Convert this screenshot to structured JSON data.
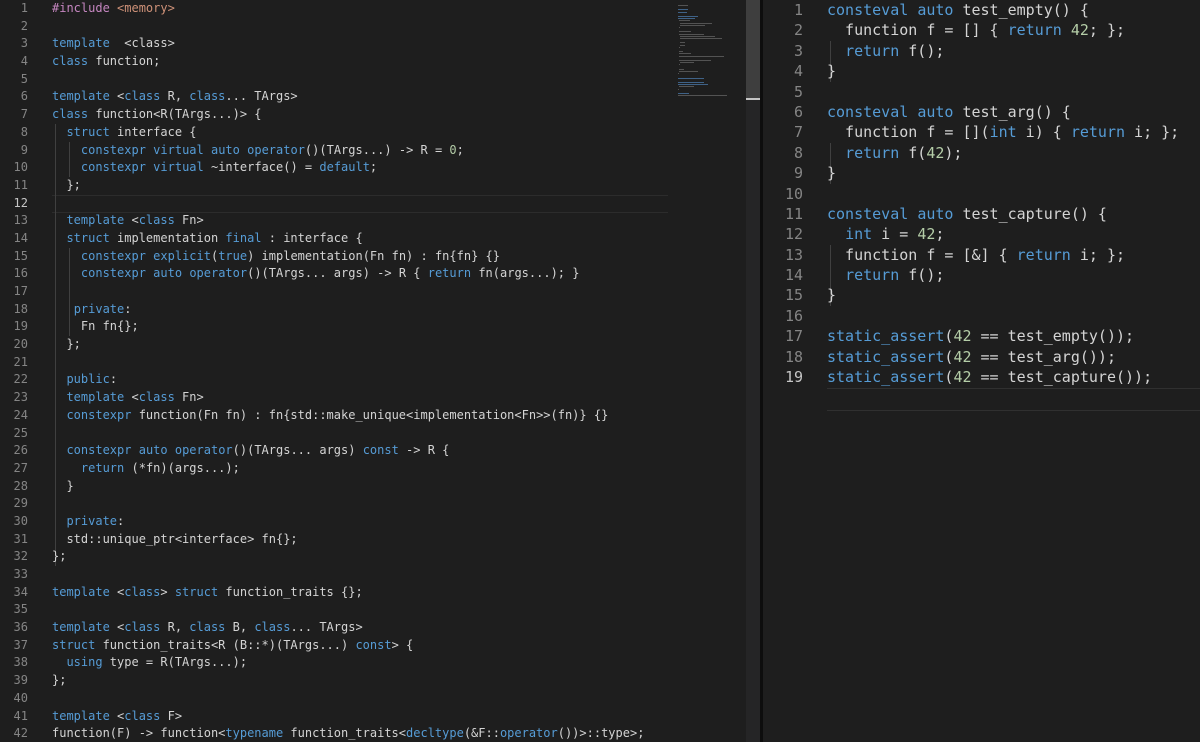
{
  "colors": {
    "background": "#1e1e1e",
    "keyword": "#569cd6",
    "number": "#b5cea8",
    "text": "#d4d4d4",
    "line_number": "#858585"
  },
  "left_editor": {
    "active_line": 12,
    "lines": [
      {
        "n": "1",
        "t": [
          [
            "inc",
            "#include "
          ],
          [
            "str",
            "<memory>"
          ]
        ]
      },
      {
        "n": "2",
        "t": []
      },
      {
        "n": "3",
        "t": [
          [
            "kw",
            "template"
          ],
          [
            "",
            "  <class>"
          ]
        ]
      },
      {
        "n": "4",
        "t": [
          [
            "kw",
            "class"
          ],
          [
            "",
            " function;"
          ]
        ]
      },
      {
        "n": "5",
        "t": []
      },
      {
        "n": "6",
        "t": [
          [
            "kw",
            "template"
          ],
          [
            "",
            " <"
          ],
          [
            "kw",
            "class"
          ],
          [
            "",
            " R, "
          ],
          [
            "kw",
            "class"
          ],
          [
            "",
            "... TArgs>"
          ]
        ]
      },
      {
        "n": "7",
        "t": [
          [
            "kw",
            "class"
          ],
          [
            "",
            " function<R(TArgs...)> {"
          ]
        ]
      },
      {
        "n": "8",
        "t": [
          [
            "",
            "  "
          ],
          [
            "kw",
            "struct"
          ],
          [
            "",
            " interface {"
          ]
        ]
      },
      {
        "n": "9",
        "t": [
          [
            "",
            "    "
          ],
          [
            "kw",
            "constexpr"
          ],
          [
            "",
            " "
          ],
          [
            "kw",
            "virtual"
          ],
          [
            "",
            " "
          ],
          [
            "kw",
            "auto"
          ],
          [
            "",
            " "
          ],
          [
            "kw",
            "operator"
          ],
          [
            "",
            "()(TArgs...) -> R = "
          ],
          [
            "num",
            "0"
          ],
          [
            "",
            ";"
          ]
        ]
      },
      {
        "n": "10",
        "t": [
          [
            "",
            "    "
          ],
          [
            "kw",
            "constexpr"
          ],
          [
            "",
            " "
          ],
          [
            "kw",
            "virtual"
          ],
          [
            "",
            " ~interface() = "
          ],
          [
            "kw",
            "default"
          ],
          [
            "",
            ";"
          ]
        ]
      },
      {
        "n": "11",
        "t": [
          [
            "",
            "  };"
          ]
        ]
      },
      {
        "n": "12",
        "t": []
      },
      {
        "n": "13",
        "t": [
          [
            "",
            "  "
          ],
          [
            "kw",
            "template"
          ],
          [
            "",
            " <"
          ],
          [
            "kw",
            "class"
          ],
          [
            "",
            " Fn>"
          ]
        ]
      },
      {
        "n": "14",
        "t": [
          [
            "",
            "  "
          ],
          [
            "kw",
            "struct"
          ],
          [
            "",
            " implementation "
          ],
          [
            "kw",
            "final"
          ],
          [
            "",
            " : interface {"
          ]
        ]
      },
      {
        "n": "15",
        "t": [
          [
            "",
            "    "
          ],
          [
            "kw",
            "constexpr"
          ],
          [
            "",
            " "
          ],
          [
            "kw",
            "explicit"
          ],
          [
            "",
            "("
          ],
          [
            "kw",
            "true"
          ],
          [
            "",
            ") implementation(Fn fn) : fn{fn} {}"
          ]
        ]
      },
      {
        "n": "16",
        "t": [
          [
            "",
            "    "
          ],
          [
            "kw",
            "constexpr"
          ],
          [
            "",
            " "
          ],
          [
            "kw",
            "auto"
          ],
          [
            "",
            " "
          ],
          [
            "kw",
            "operator"
          ],
          [
            "",
            "()(TArgs... args) -> R { "
          ],
          [
            "kw",
            "return"
          ],
          [
            "",
            " fn(args...); }"
          ]
        ]
      },
      {
        "n": "17",
        "t": []
      },
      {
        "n": "18",
        "t": [
          [
            "",
            "   "
          ],
          [
            "kw",
            "private"
          ],
          [
            "",
            ":"
          ]
        ]
      },
      {
        "n": "19",
        "t": [
          [
            "",
            "    Fn fn{};"
          ]
        ]
      },
      {
        "n": "20",
        "t": [
          [
            "",
            "  };"
          ]
        ]
      },
      {
        "n": "21",
        "t": []
      },
      {
        "n": "22",
        "t": [
          [
            "",
            "  "
          ],
          [
            "kw",
            "public"
          ],
          [
            "",
            ":"
          ]
        ]
      },
      {
        "n": "23",
        "t": [
          [
            "",
            "  "
          ],
          [
            "kw",
            "template"
          ],
          [
            "",
            " <"
          ],
          [
            "kw",
            "class"
          ],
          [
            "",
            " Fn>"
          ]
        ]
      },
      {
        "n": "24",
        "t": [
          [
            "",
            "  "
          ],
          [
            "kw",
            "constexpr"
          ],
          [
            "",
            " function(Fn fn) : fn{std::make_unique<implementation<Fn>>(fn)} {}"
          ]
        ]
      },
      {
        "n": "25",
        "t": []
      },
      {
        "n": "26",
        "t": [
          [
            "",
            "  "
          ],
          [
            "kw",
            "constexpr"
          ],
          [
            "",
            " "
          ],
          [
            "kw",
            "auto"
          ],
          [
            "",
            " "
          ],
          [
            "kw",
            "operator"
          ],
          [
            "",
            "()(TArgs... args) "
          ],
          [
            "kw",
            "const"
          ],
          [
            "",
            " -> R {"
          ]
        ]
      },
      {
        "n": "27",
        "t": [
          [
            "",
            "    "
          ],
          [
            "kw",
            "return"
          ],
          [
            "",
            " (*fn)(args...);"
          ]
        ]
      },
      {
        "n": "28",
        "t": [
          [
            "",
            "  }"
          ]
        ]
      },
      {
        "n": "29",
        "t": []
      },
      {
        "n": "30",
        "t": [
          [
            "",
            "  "
          ],
          [
            "kw",
            "private"
          ],
          [
            "",
            ":"
          ]
        ]
      },
      {
        "n": "31",
        "t": [
          [
            "",
            "  std::unique_ptr<interface> fn{};"
          ]
        ]
      },
      {
        "n": "32",
        "t": [
          [
            "",
            "};"
          ]
        ]
      },
      {
        "n": "33",
        "t": []
      },
      {
        "n": "34",
        "t": [
          [
            "kw",
            "template"
          ],
          [
            "",
            " <"
          ],
          [
            "kw",
            "class"
          ],
          [
            "",
            "> "
          ],
          [
            "kw",
            "struct"
          ],
          [
            "",
            " function_traits {};"
          ]
        ]
      },
      {
        "n": "35",
        "t": []
      },
      {
        "n": "36",
        "t": [
          [
            "kw",
            "template"
          ],
          [
            "",
            " <"
          ],
          [
            "kw",
            "class"
          ],
          [
            "",
            " R, "
          ],
          [
            "kw",
            "class"
          ],
          [
            "",
            " B, "
          ],
          [
            "kw",
            "class"
          ],
          [
            "",
            "... TArgs>"
          ]
        ]
      },
      {
        "n": "37",
        "t": [
          [
            "kw",
            "struct"
          ],
          [
            "",
            " function_traits<R (B::*)(TArgs...) "
          ],
          [
            "kw",
            "const"
          ],
          [
            "",
            "> {"
          ]
        ]
      },
      {
        "n": "38",
        "t": [
          [
            "",
            "  "
          ],
          [
            "kw",
            "using"
          ],
          [
            "",
            " type = R(TArgs...);"
          ]
        ]
      },
      {
        "n": "39",
        "t": [
          [
            "",
            "};"
          ]
        ]
      },
      {
        "n": "40",
        "t": []
      },
      {
        "n": "41",
        "t": [
          [
            "kw",
            "template"
          ],
          [
            "",
            " <"
          ],
          [
            "kw",
            "class"
          ],
          [
            "",
            " F>"
          ]
        ]
      },
      {
        "n": "42",
        "t": [
          [
            "",
            "function(F) -> function<"
          ],
          [
            "kw",
            "typename"
          ],
          [
            "",
            " function_traits<"
          ],
          [
            "kw",
            "decltype"
          ],
          [
            "",
            "(&F::"
          ],
          [
            "kw",
            "operator"
          ],
          [
            "",
            "())>::type>;"
          ]
        ]
      }
    ]
  },
  "right_editor": {
    "active_line": 19,
    "lines": [
      {
        "n": "1",
        "t": [
          [
            "kw",
            "consteval"
          ],
          [
            "",
            " "
          ],
          [
            "kw",
            "auto"
          ],
          [
            "",
            " test_empty() {"
          ]
        ]
      },
      {
        "n": "2",
        "t": [
          [
            "",
            "  function f = [] { "
          ],
          [
            "kw",
            "return"
          ],
          [
            "",
            " "
          ],
          [
            "num",
            "42"
          ],
          [
            "",
            "; };"
          ]
        ]
      },
      {
        "n": "3",
        "t": [
          [
            "",
            "  "
          ],
          [
            "kw",
            "return"
          ],
          [
            "",
            " f();"
          ]
        ]
      },
      {
        "n": "4",
        "t": [
          [
            "",
            "}"
          ]
        ]
      },
      {
        "n": "5",
        "t": []
      },
      {
        "n": "6",
        "t": [
          [
            "kw",
            "consteval"
          ],
          [
            "",
            " "
          ],
          [
            "kw",
            "auto"
          ],
          [
            "",
            " test_arg() {"
          ]
        ]
      },
      {
        "n": "7",
        "t": [
          [
            "",
            "  function f = []("
          ],
          [
            "kw",
            "int"
          ],
          [
            "",
            " i) { "
          ],
          [
            "kw",
            "return"
          ],
          [
            "",
            " i; };"
          ]
        ]
      },
      {
        "n": "8",
        "t": [
          [
            "",
            "  "
          ],
          [
            "kw",
            "return"
          ],
          [
            "",
            " f("
          ],
          [
            "num",
            "42"
          ],
          [
            "",
            ");"
          ]
        ]
      },
      {
        "n": "9",
        "t": [
          [
            "",
            "}"
          ]
        ]
      },
      {
        "n": "10",
        "t": []
      },
      {
        "n": "11",
        "t": [
          [
            "kw",
            "consteval"
          ],
          [
            "",
            " "
          ],
          [
            "kw",
            "auto"
          ],
          [
            "",
            " test_capture() {"
          ]
        ]
      },
      {
        "n": "12",
        "t": [
          [
            "",
            "  "
          ],
          [
            "kw",
            "int"
          ],
          [
            "",
            " i = "
          ],
          [
            "num",
            "42"
          ],
          [
            "",
            ";"
          ]
        ]
      },
      {
        "n": "13",
        "t": [
          [
            "",
            "  function f = [&] { "
          ],
          [
            "kw",
            "return"
          ],
          [
            "",
            " i; };"
          ]
        ]
      },
      {
        "n": "14",
        "t": [
          [
            "",
            "  "
          ],
          [
            "kw",
            "return"
          ],
          [
            "",
            " f();"
          ]
        ]
      },
      {
        "n": "15",
        "t": [
          [
            "",
            "}"
          ]
        ]
      },
      {
        "n": "16",
        "t": []
      },
      {
        "n": "17",
        "t": [
          [
            "kw",
            "static_assert"
          ],
          [
            "",
            "("
          ],
          [
            "num",
            "42"
          ],
          [
            "",
            " == test_empty());"
          ]
        ]
      },
      {
        "n": "18",
        "t": [
          [
            "kw",
            "static_assert"
          ],
          [
            "",
            "("
          ],
          [
            "num",
            "42"
          ],
          [
            "",
            " == test_arg());"
          ]
        ]
      },
      {
        "n": "19",
        "t": [
          [
            "kw",
            "static_assert"
          ],
          [
            "",
            "("
          ],
          [
            "num",
            "42"
          ],
          [
            "",
            " == test_capture());"
          ]
        ]
      }
    ]
  }
}
